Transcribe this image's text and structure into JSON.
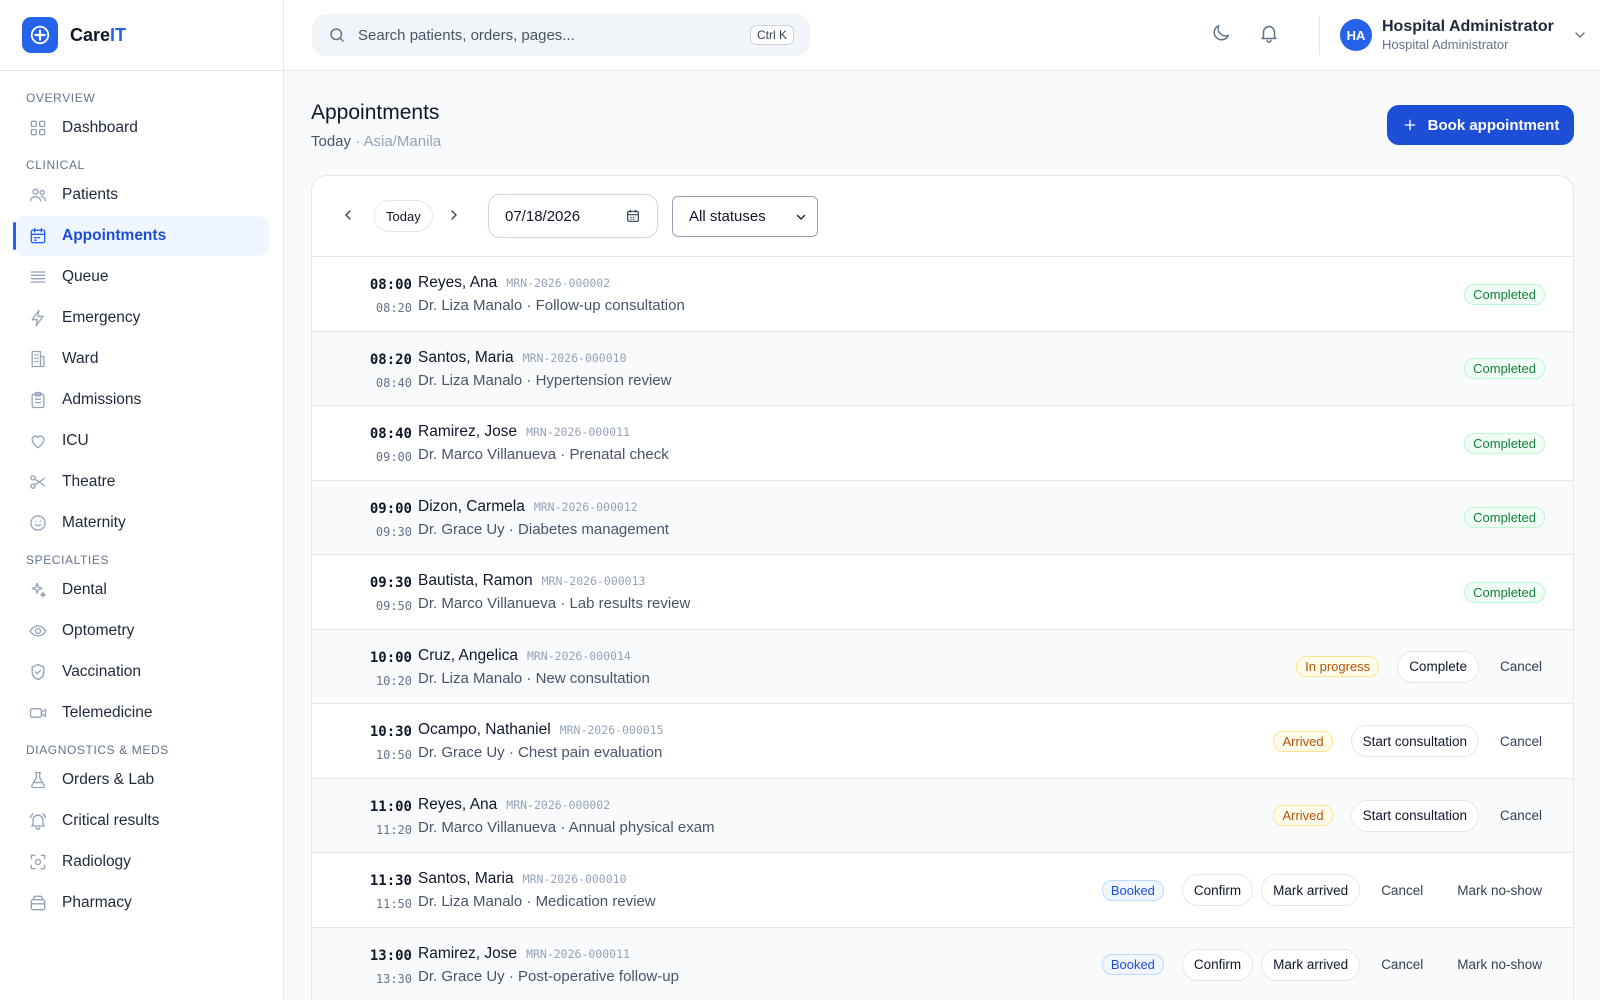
{
  "brand": {
    "name_a": "Care",
    "name_b": "IT"
  },
  "search": {
    "placeholder": "Search patients, orders, pages...",
    "shortcut": "Ctrl K"
  },
  "user": {
    "initials": "HA",
    "name": "Hospital Administrator",
    "role": "Hospital Administrator"
  },
  "nav": {
    "sections": [
      {
        "title": "OVERVIEW",
        "items": [
          {
            "label": "Dashboard",
            "icon": "grid-icon"
          }
        ]
      },
      {
        "title": "CLINICAL",
        "items": [
          {
            "label": "Patients",
            "icon": "users-icon"
          },
          {
            "label": "Appointments",
            "icon": "calendar-icon",
            "active": true
          },
          {
            "label": "Queue",
            "icon": "list-icon"
          },
          {
            "label": "Emergency",
            "icon": "zap-icon"
          },
          {
            "label": "Ward",
            "icon": "building-icon"
          },
          {
            "label": "Admissions",
            "icon": "clipboard-icon"
          },
          {
            "label": "ICU",
            "icon": "heart-icon"
          },
          {
            "label": "Theatre",
            "icon": "scissors-icon"
          },
          {
            "label": "Maternity",
            "icon": "smile-icon"
          }
        ]
      },
      {
        "title": "SPECIALTIES",
        "items": [
          {
            "label": "Dental",
            "icon": "sparkles-icon"
          },
          {
            "label": "Optometry",
            "icon": "eye-icon"
          },
          {
            "label": "Vaccination",
            "icon": "shield-icon"
          },
          {
            "label": "Telemedicine",
            "icon": "video-icon"
          }
        ]
      },
      {
        "title": "DIAGNOSTICS & MEDS",
        "items": [
          {
            "label": "Orders & Lab",
            "icon": "flask-icon"
          },
          {
            "label": "Critical results",
            "icon": "bell-alert-icon"
          },
          {
            "label": "Radiology",
            "icon": "scan-icon"
          },
          {
            "label": "Pharmacy",
            "icon": "pill-box-icon"
          }
        ]
      }
    ]
  },
  "page": {
    "title": "Appointments",
    "subtitle": "Today",
    "separator": " · ",
    "timezone": "Asia/Manila",
    "book_label": "Book appointment"
  },
  "filters": {
    "today_label": "Today",
    "date_value": "07/18/2026",
    "status_value": "All statuses"
  },
  "appointments": [
    {
      "start": "08:00",
      "end": "08:20",
      "patient": "Reyes, Ana",
      "mrn": "MRN-2026-000002",
      "doctor": "Dr. Liza Manalo",
      "reason": "Follow-up consultation",
      "status": "Completed",
      "status_key": "completed",
      "actions": []
    },
    {
      "start": "08:20",
      "end": "08:40",
      "patient": "Santos, Maria",
      "mrn": "MRN-2026-000010",
      "doctor": "Dr. Liza Manalo",
      "reason": "Hypertension review",
      "status": "Completed",
      "status_key": "completed",
      "actions": []
    },
    {
      "start": "08:40",
      "end": "09:00",
      "patient": "Ramirez, Jose",
      "mrn": "MRN-2026-000011",
      "doctor": "Dr. Marco Villanueva",
      "reason": "Prenatal check",
      "status": "Completed",
      "status_key": "completed",
      "actions": []
    },
    {
      "start": "09:00",
      "end": "09:30",
      "patient": "Dizon, Carmela",
      "mrn": "MRN-2026-000012",
      "doctor": "Dr. Grace Uy",
      "reason": "Diabetes management",
      "status": "Completed",
      "status_key": "completed",
      "actions": []
    },
    {
      "start": "09:30",
      "end": "09:50",
      "patient": "Bautista, Ramon",
      "mrn": "MRN-2026-000013",
      "doctor": "Dr. Marco Villanueva",
      "reason": "Lab results review",
      "status": "Completed",
      "status_key": "completed",
      "actions": []
    },
    {
      "start": "10:00",
      "end": "10:20",
      "patient": "Cruz, Angelica",
      "mrn": "MRN-2026-000014",
      "doctor": "Dr. Liza Manalo",
      "reason": "New consultation",
      "status": "In progress",
      "status_key": "inprogress",
      "actions": [
        {
          "label": "Complete",
          "style": "outline"
        },
        {
          "label": "Cancel",
          "style": "text"
        }
      ]
    },
    {
      "start": "10:30",
      "end": "10:50",
      "patient": "Ocampo, Nathaniel",
      "mrn": "MRN-2026-000015",
      "doctor": "Dr. Grace Uy",
      "reason": "Chest pain evaluation",
      "status": "Arrived",
      "status_key": "arrived",
      "actions": [
        {
          "label": "Start consultation",
          "style": "outline"
        },
        {
          "label": "Cancel",
          "style": "text"
        }
      ]
    },
    {
      "start": "11:00",
      "end": "11:20",
      "patient": "Reyes, Ana",
      "mrn": "MRN-2026-000002",
      "doctor": "Dr. Marco Villanueva",
      "reason": "Annual physical exam",
      "status": "Arrived",
      "status_key": "arrived",
      "actions": [
        {
          "label": "Start consultation",
          "style": "outline"
        },
        {
          "label": "Cancel",
          "style": "text"
        }
      ]
    },
    {
      "start": "11:30",
      "end": "11:50",
      "patient": "Santos, Maria",
      "mrn": "MRN-2026-000010",
      "doctor": "Dr. Liza Manalo",
      "reason": "Medication review",
      "status": "Booked",
      "status_key": "booked",
      "actions": [
        {
          "label": "Confirm",
          "style": "outline"
        },
        {
          "label": "Mark arrived",
          "style": "outline"
        },
        {
          "label": "Cancel",
          "style": "text"
        },
        {
          "label": "Mark no-show",
          "style": "text"
        }
      ]
    },
    {
      "start": "13:00",
      "end": "13:30",
      "patient": "Ramirez, Jose",
      "mrn": "MRN-2026-000011",
      "doctor": "Dr. Grace Uy",
      "reason": "Post-operative follow-up",
      "status": "Booked",
      "status_key": "booked",
      "actions": [
        {
          "label": "Confirm",
          "style": "outline"
        },
        {
          "label": "Mark arrived",
          "style": "outline"
        },
        {
          "label": "Cancel",
          "style": "text"
        },
        {
          "label": "Mark no-show",
          "style": "text"
        }
      ]
    }
  ],
  "colors": {
    "accent": "#2563eb",
    "completed": "#15803d",
    "arrived": "#b45309",
    "booked": "#1d4ed8"
  }
}
